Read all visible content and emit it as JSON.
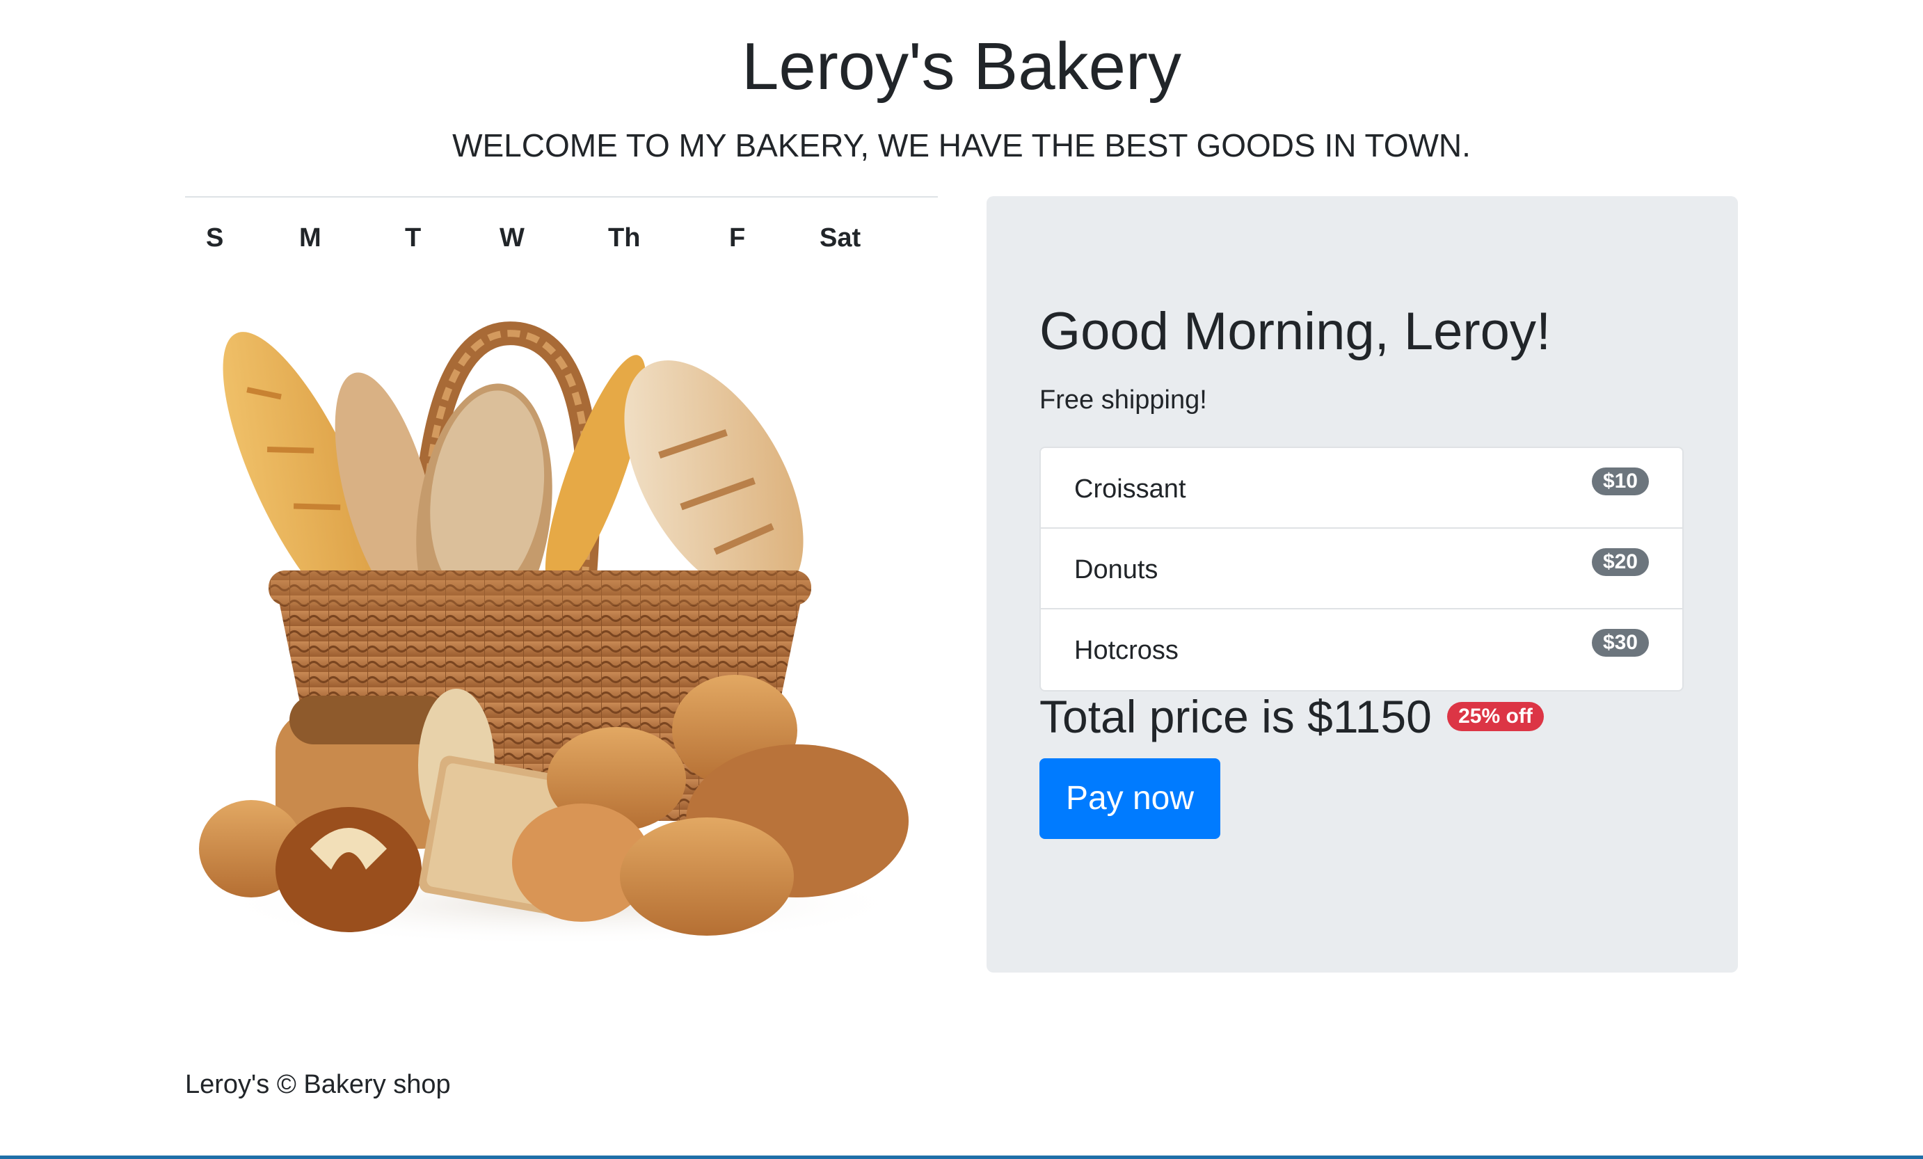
{
  "header": {
    "title": "Leroy's Bakery",
    "subtitle": "WELCOME TO MY BAKERY, WE HAVE THE BEST GOODS IN TOWN."
  },
  "week": {
    "days": [
      "S",
      "M",
      "T",
      "W",
      "Th",
      "F",
      "Sat"
    ]
  },
  "hero_image": {
    "icon": "bread-basket-image"
  },
  "panel": {
    "greeting": "Good Morning, Leroy!",
    "shipping": "Free shipping!",
    "items": [
      {
        "label": "Croissant",
        "price": "$10"
      },
      {
        "label": "Donuts",
        "price": "$20"
      },
      {
        "label": "Hotcross",
        "price": "$30"
      }
    ],
    "total_text": "Total price is $1150",
    "discount": "25% off",
    "pay_label": "Pay now"
  },
  "footer": {
    "text": "Leroy's © Bakery shop"
  },
  "colors": {
    "primary": "#007bff",
    "secondary_badge": "#6c757d",
    "danger_badge": "#dc3545",
    "panel_bg": "#e9ecef"
  }
}
